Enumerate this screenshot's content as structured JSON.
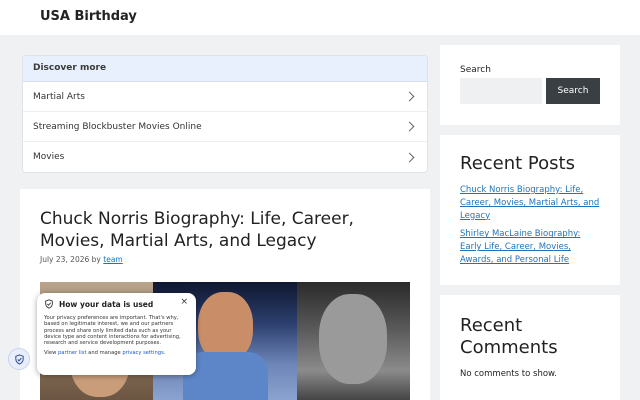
{
  "site": {
    "title": "USA Birthday"
  },
  "discover": {
    "heading": "Discover more",
    "items": [
      {
        "label": "Martial Arts"
      },
      {
        "label": "Streaming Blockbuster Movies Online"
      },
      {
        "label": "Movies"
      }
    ]
  },
  "article": {
    "title": "Chuck Norris Biography: Life, Career, Movies, Martial Arts, and Legacy",
    "date": "July 23, 2026",
    "by": "by",
    "author": "team"
  },
  "privacy": {
    "title": "How your data is used",
    "close": "×",
    "body": "Your privacy preferences are important. That's why, based on legitimate interest, we and our partners process and share only limited data such as your device type and content interactions for advertising, research and service development purposes.",
    "foot_prefix": "View",
    "partner_link": "partner list",
    "foot_middle": "and manage",
    "settings_link": "privacy settings",
    "foot_suffix": "."
  },
  "sidebar": {
    "search_label": "Search",
    "search_placeholder": "",
    "search_button": "Search",
    "recent_title": "Recent Posts",
    "recent_posts": [
      {
        "title": "Chuck Norris Biography: Life, Career, Movies, Martial Arts, and Legacy"
      },
      {
        "title": "Shirley MacLaine Biography: Early Life, Career, Movies, Awards, and Personal Life"
      }
    ],
    "comments_title": "Recent Comments",
    "no_comments": "No comments to show."
  },
  "colors": {
    "link": "#1e73be",
    "button": "#3a3f44",
    "discover_head": "#e8f0fe"
  },
  "icons": [
    "chevron-right-icon",
    "shield-icon",
    "close-icon"
  ]
}
